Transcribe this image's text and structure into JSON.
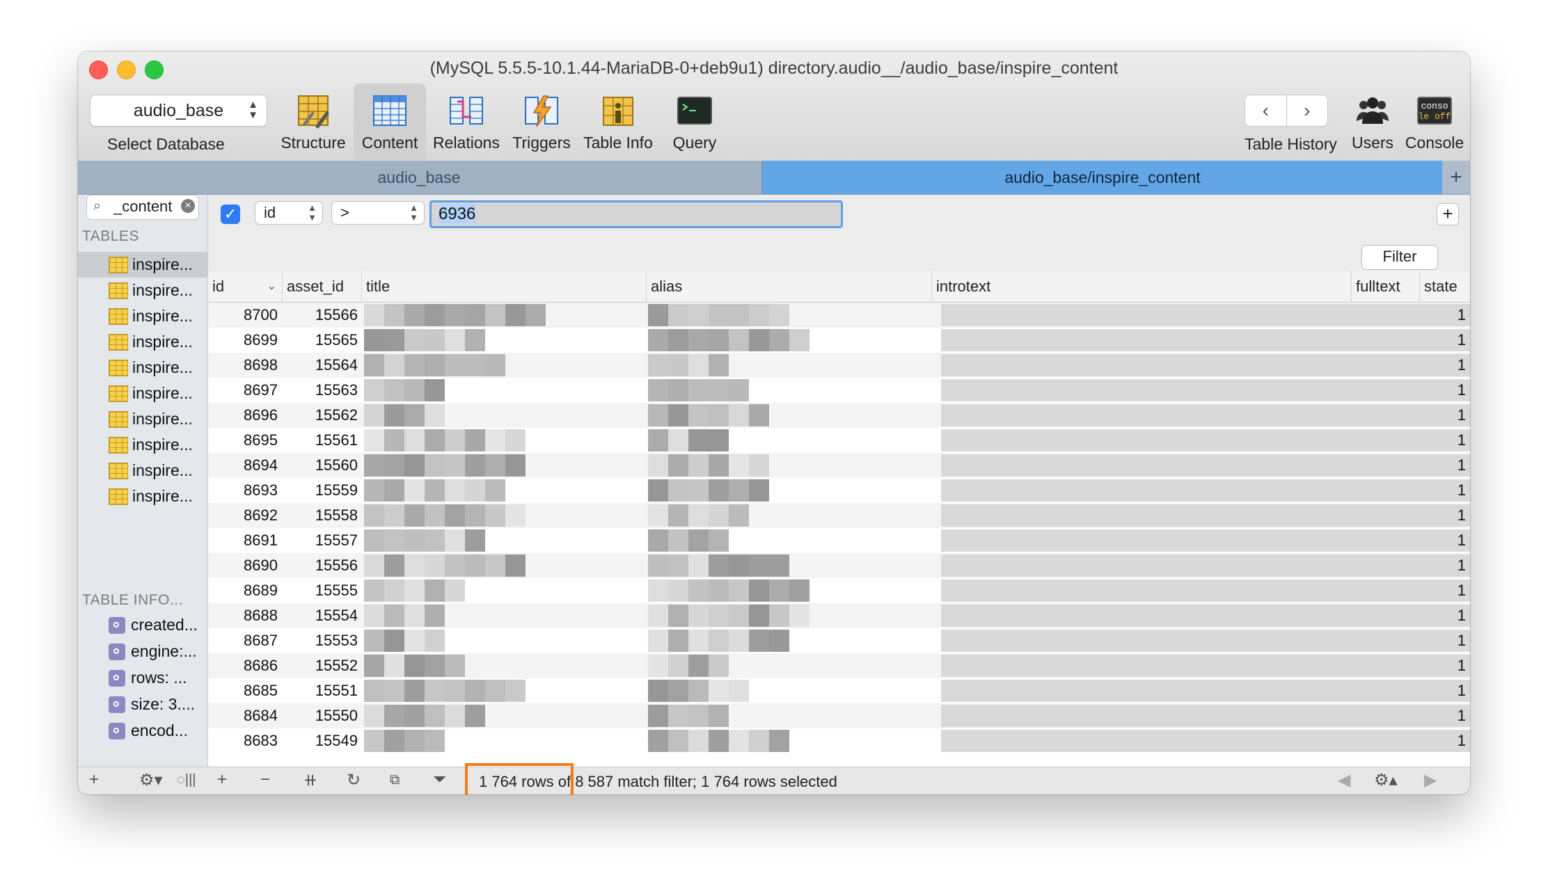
{
  "window": {
    "title": "(MySQL 5.5.5-10.1.44-MariaDB-0+deb9u1) directory.audio__/audio_base/inspire_content"
  },
  "toolbar": {
    "database_value": "audio_base",
    "select_database_label": "Select Database",
    "buttons": [
      {
        "label": "Structure",
        "icon": "structure-icon"
      },
      {
        "label": "Content",
        "icon": "content-icon"
      },
      {
        "label": "Relations",
        "icon": "relations-icon"
      },
      {
        "label": "Triggers",
        "icon": "triggers-icon"
      },
      {
        "label": "Table Info",
        "icon": "table-info-icon"
      },
      {
        "label": "Query",
        "icon": "query-icon"
      }
    ],
    "history_label": "Table History",
    "users_label": "Users",
    "console_label": "Console",
    "console_icon_text_1": "conso",
    "console_icon_text_2": "le off"
  },
  "tabs": [
    {
      "label": "audio_base"
    },
    {
      "label": "audio_base/inspire_content"
    }
  ],
  "sidebar": {
    "search_value": "_content",
    "tables_header": "TABLES",
    "tables": [
      "inspire...",
      "inspire...",
      "inspire...",
      "inspire...",
      "inspire...",
      "inspire...",
      "inspire...",
      "inspire...",
      "inspire...",
      "inspire..."
    ],
    "info_header": "TABLE INFO...",
    "info_items": [
      "created...",
      "engine:...",
      "rows: ...",
      "size: 3....",
      "encod..."
    ]
  },
  "filter": {
    "field": "id",
    "operator": ">",
    "value": "6936",
    "button_label": "Filter"
  },
  "table": {
    "columns": [
      "id",
      "asset_id",
      "title",
      "alias",
      "introtext",
      "fulltext",
      "state"
    ],
    "rows": [
      {
        "id": "8700",
        "asset_id": "15566",
        "state": "1"
      },
      {
        "id": "8699",
        "asset_id": "15565",
        "state": "1"
      },
      {
        "id": "8698",
        "asset_id": "15564",
        "state": "1"
      },
      {
        "id": "8697",
        "asset_id": "15563",
        "state": "1"
      },
      {
        "id": "8696",
        "asset_id": "15562",
        "state": "1"
      },
      {
        "id": "8695",
        "asset_id": "15561",
        "state": "1"
      },
      {
        "id": "8694",
        "asset_id": "15560",
        "state": "1"
      },
      {
        "id": "8693",
        "asset_id": "15559",
        "state": "1"
      },
      {
        "id": "8692",
        "asset_id": "15558",
        "state": "1"
      },
      {
        "id": "8691",
        "asset_id": "15557",
        "state": "1"
      },
      {
        "id": "8690",
        "asset_id": "15556",
        "state": "1"
      },
      {
        "id": "8689",
        "asset_id": "15555",
        "state": "1"
      },
      {
        "id": "8688",
        "asset_id": "15554",
        "state": "1"
      },
      {
        "id": "8687",
        "asset_id": "15553",
        "state": "1"
      },
      {
        "id": "8686",
        "asset_id": "15552",
        "state": "1"
      },
      {
        "id": "8685",
        "asset_id": "15551",
        "state": "1"
      },
      {
        "id": "8684",
        "asset_id": "15550",
        "state": "1"
      },
      {
        "id": "8683",
        "asset_id": "15549",
        "state": "1"
      }
    ]
  },
  "status": {
    "text": "1 764 rows of 8 587 match filter; 1 764 rows selected"
  },
  "colors": {
    "active_tab": "#63a6e6",
    "inactive_tab": "#9fb1c3",
    "focus_ring": "#5f9de8",
    "annotation": "#f07c1a",
    "checkbox": "#2f7bf5"
  }
}
